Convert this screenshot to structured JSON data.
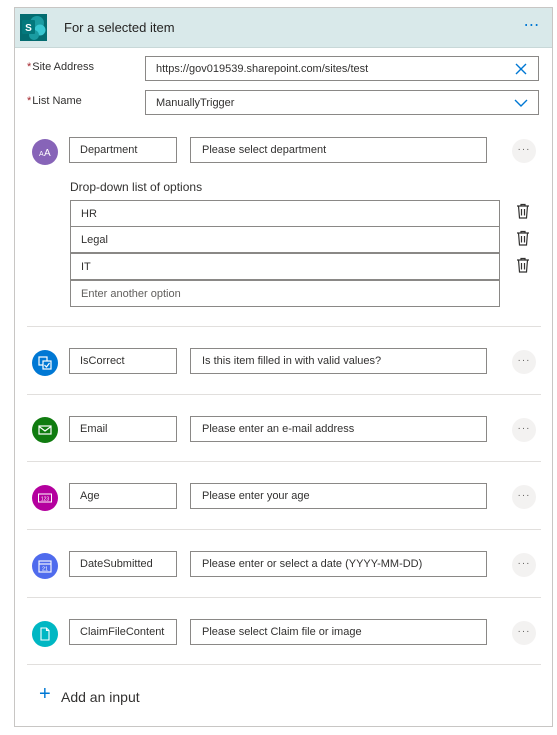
{
  "header": {
    "title": "For a selected item",
    "more_label": "⋯",
    "logo_letter": "S"
  },
  "site_address": {
    "label": "Site Address",
    "required_mark": "*",
    "value": "https://gov019539.sharepoint.com/sites/test"
  },
  "list_name": {
    "label": "List Name",
    "required_mark": "*",
    "value": "ManuallyTrigger"
  },
  "inputs": [
    {
      "name": "Department",
      "placeholder": "Please select department",
      "icon": "text-aa-icon",
      "color": "#8764b8"
    },
    {
      "name": "IsCorrect",
      "placeholder": "Is this item filled in with valid values?",
      "icon": "checkbox-icon",
      "color": "#0078d4"
    },
    {
      "name": "Email",
      "placeholder": "Please enter an e-mail address",
      "icon": "mail-icon",
      "color": "#107c10"
    },
    {
      "name": "Age",
      "placeholder": "Please enter your age",
      "icon": "number-icon",
      "color": "#b4009e"
    },
    {
      "name": "DateSubmitted",
      "placeholder": "Please enter or select a date (YYYY-MM-DD)",
      "icon": "calendar-icon",
      "color": "#4f6bed"
    },
    {
      "name": "ClaimFileContent",
      "placeholder": "Please select Claim file or image",
      "icon": "file-icon",
      "color": "#00b7c3"
    }
  ],
  "dropdown": {
    "label": "Drop-down list of options",
    "options": [
      "HR",
      "Legal",
      "IT"
    ],
    "new_option_placeholder": "Enter another option"
  },
  "row_more_label": "···",
  "add_input": {
    "plus": "+",
    "label": "Add an input"
  }
}
